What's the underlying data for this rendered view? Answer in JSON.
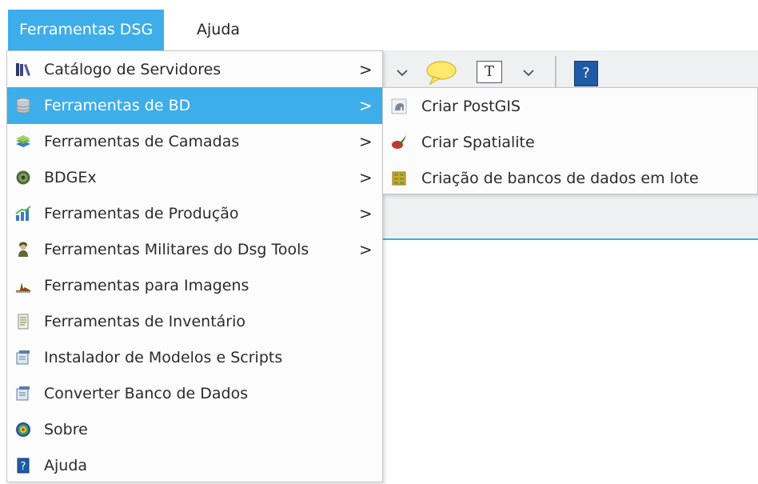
{
  "menubar": {
    "items": [
      {
        "label": "Ferramentas DSG"
      },
      {
        "label": "Ajuda"
      }
    ]
  },
  "toolbar": {
    "text_tool_glyph": "T",
    "help_glyph": "?"
  },
  "main_menu": {
    "items": [
      {
        "label": "Catálogo de Servidores",
        "icon": "books-icon",
        "submenu": true
      },
      {
        "label": "Ferramentas de BD",
        "icon": "database-icon",
        "submenu": true,
        "highlighted": true
      },
      {
        "label": "Ferramentas de Camadas",
        "icon": "layers-icon",
        "submenu": true
      },
      {
        "label": "BDGEx",
        "icon": "globe-icon",
        "submenu": true
      },
      {
        "label": "Ferramentas de Produção",
        "icon": "production-chart-icon",
        "submenu": true
      },
      {
        "label": "Ferramentas Militares do Dsg Tools",
        "icon": "soldier-icon",
        "submenu": true
      },
      {
        "label": "Ferramentas para Imagens",
        "icon": "histogram-icon",
        "submenu": false
      },
      {
        "label": "Ferramentas de Inventário",
        "icon": "document-list-icon",
        "submenu": false
      },
      {
        "label": "Instalador de Modelos e Scripts",
        "icon": "installer-icon",
        "submenu": false
      },
      {
        "label": "Converter Banco de Dados",
        "icon": "convert-icon",
        "submenu": false
      },
      {
        "label": "Sobre",
        "icon": "target-icon",
        "submenu": false
      },
      {
        "label": "Ajuda",
        "icon": "help-book-icon",
        "submenu": false
      }
    ],
    "submenu_arrow": ">"
  },
  "sub_menu": {
    "items": [
      {
        "label": "Criar PostGIS",
        "icon": "postgis-elephant-icon"
      },
      {
        "label": "Criar Spatialite",
        "icon": "spatialite-feather-icon"
      },
      {
        "label": "Criação de bancos de dados em lote",
        "icon": "batch-database-icon"
      }
    ]
  },
  "colors": {
    "accent": "#3daee9",
    "menu_bg": "#fcfcfc",
    "toolbar_bg": "#eff0f1"
  }
}
